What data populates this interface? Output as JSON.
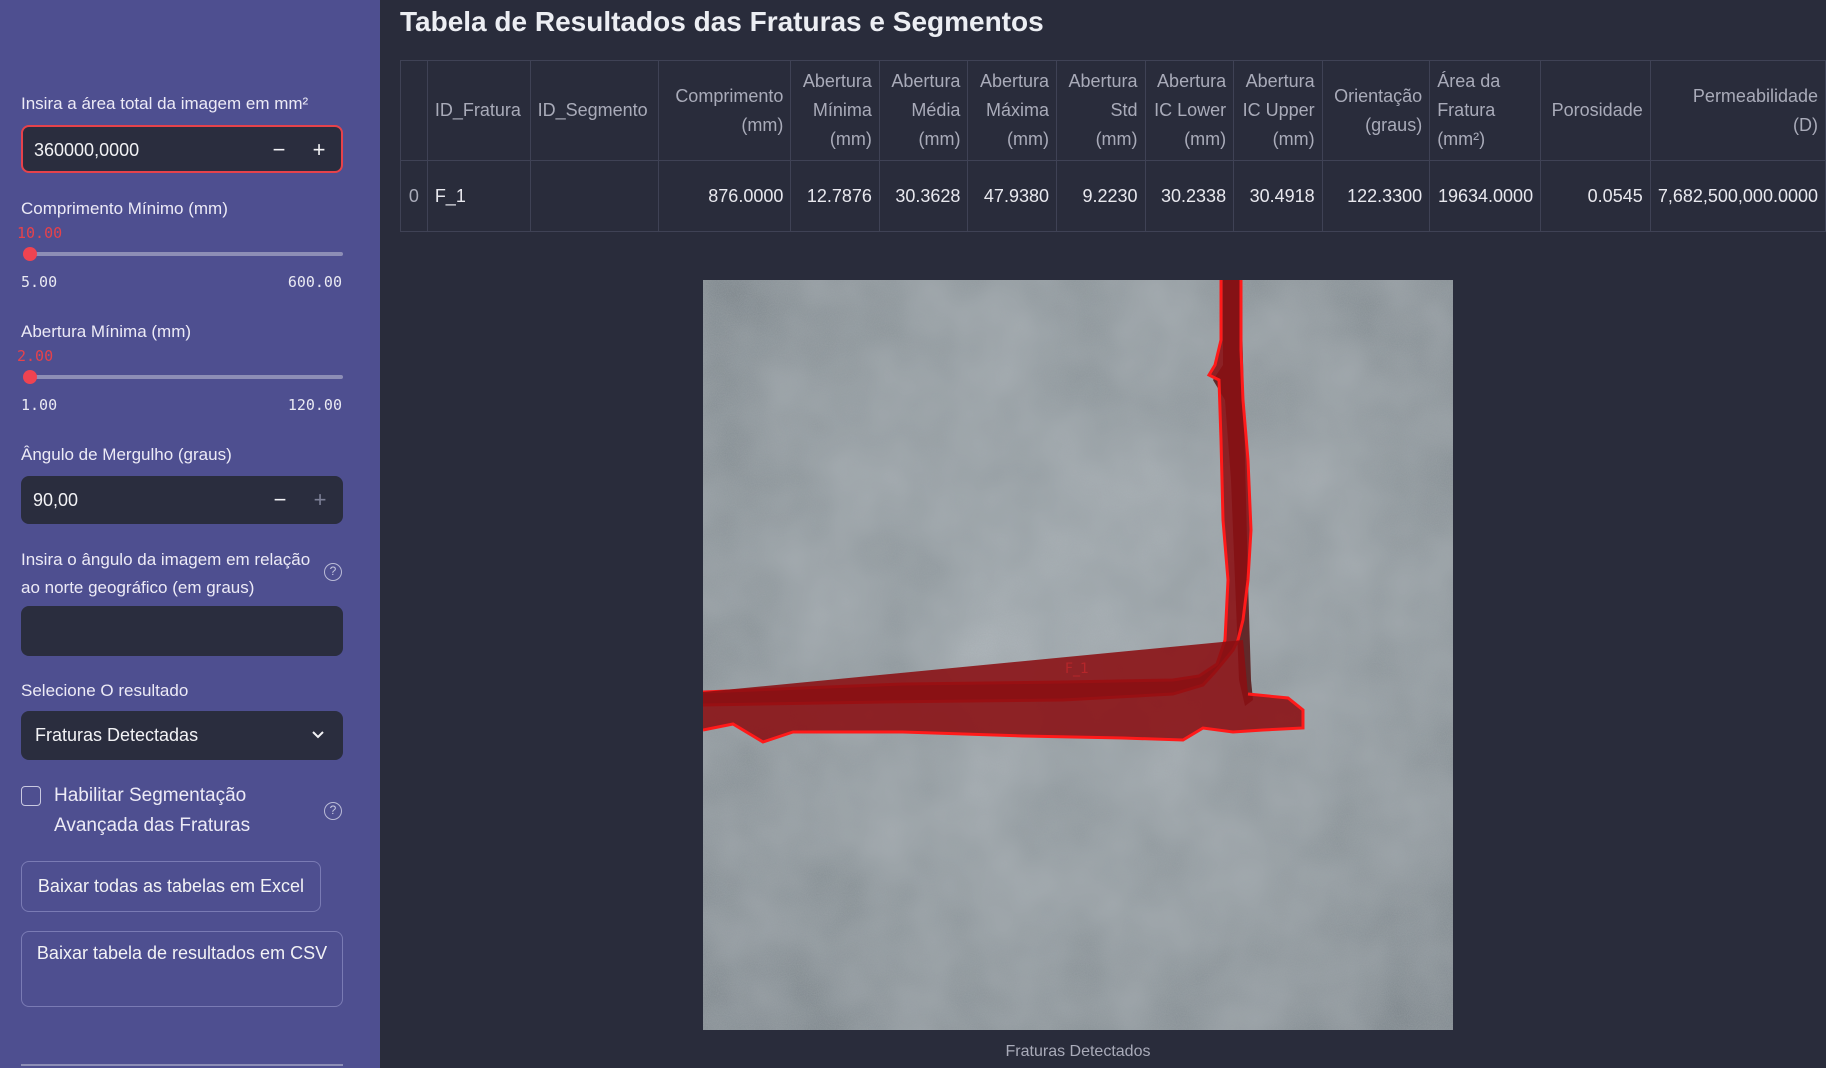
{
  "sidebar": {
    "area_label": "Insira a área total da imagem em mm²",
    "area_value": "360000,0000",
    "comp_label": "Comprimento Mínimo (mm)",
    "comp_value": "10.00",
    "comp_min": "5.00",
    "comp_max": "600.00",
    "comp_fraction": 0.008,
    "abert_label": "Abertura Mínima (mm)",
    "abert_value": "2.00",
    "abert_min": "1.00",
    "abert_max": "120.00",
    "abert_fraction": 0.008,
    "dip_label": "Ângulo de Mergulho (graus)",
    "dip_value": "90,00",
    "north_label": "Insira o ângulo da imagem em relação ao norte geográfico (em graus)",
    "north_value": "",
    "result_label": "Selecione O resultado",
    "result_value": "Fraturas Detectadas",
    "seg_checkbox_label": "Habilitar Segmentação Avançada das Fraturas",
    "seg_checked": false,
    "btn_excel": "Baixar todas as tabelas em Excel",
    "btn_csv": "Baixar tabela de resultados em CSV",
    "minus": "−",
    "plus": "+",
    "help": "?"
  },
  "main": {
    "title": "Tabela de Resultados das Fraturas e Segmentos",
    "table": {
      "headers": {
        "idx": "",
        "id_fratura": "ID_Fratura",
        "id_segmento": "ID_Segmento",
        "comprimento_1": "Comprimento",
        "comprimento_2": "(mm)",
        "ab_min_1": "Abertura",
        "ab_min_2": "Mínima",
        "ab_min_3": "(mm)",
        "ab_med_1": "Abertura",
        "ab_med_2": "Média",
        "ab_med_3": "(mm)",
        "ab_max_1": "Abertura",
        "ab_max_2": "Máxima",
        "ab_max_3": "(mm)",
        "ab_std_1": "Abertura",
        "ab_std_2": "Std",
        "ab_std_3": "(mm)",
        "ab_icl_1": "Abertura",
        "ab_icl_2": "IC Lower",
        "ab_icl_3": "(mm)",
        "ab_icu_1": "Abertura",
        "ab_icu_2": "IC Upper",
        "ab_icu_3": "(mm)",
        "ori_1": "Orientação",
        "ori_2": "(graus)",
        "area_1": "Área da",
        "area_2": "Fratura",
        "area_3": "(mm²)",
        "porosidade": "Porosidade",
        "perm_1": "Permeabilidade",
        "perm_2": "(D)"
      },
      "row": {
        "idx": "0",
        "id_fratura": "F_1",
        "id_segmento": "",
        "comprimento": "876.0000",
        "ab_min": "12.7876",
        "ab_med": "30.3628",
        "ab_max": "47.9380",
        "ab_std": "9.2230",
        "ab_icl": "30.2338",
        "ab_icu": "30.4918",
        "orientacao": "122.3300",
        "area": "19634.0000",
        "porosidade": "0.0545",
        "permeabilidade": "7,682,500,000.0000"
      }
    },
    "image_label": "F_1",
    "caption": "Fraturas Detectados"
  }
}
